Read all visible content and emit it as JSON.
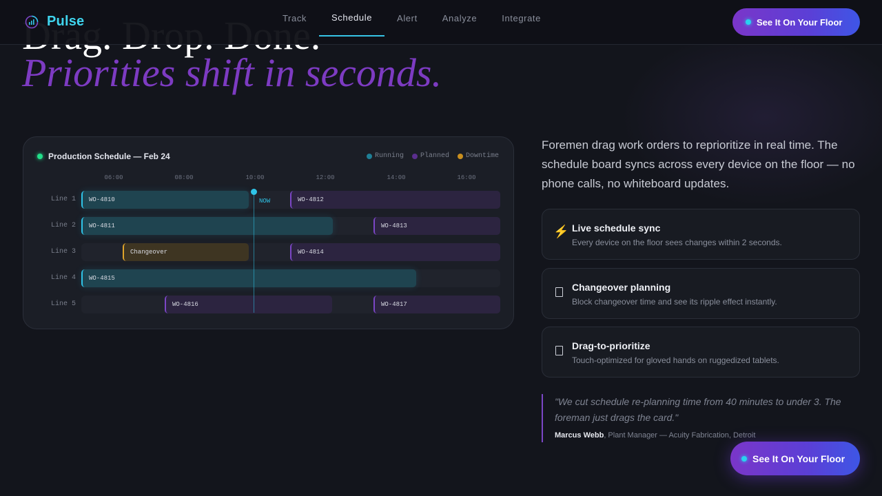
{
  "brand": {
    "name": "Pulse"
  },
  "nav": {
    "items": [
      {
        "label": "Track",
        "active": false
      },
      {
        "label": "Schedule",
        "active": true
      },
      {
        "label": "Alert",
        "active": false
      },
      {
        "label": "Analyze",
        "active": false
      },
      {
        "label": "Integrate",
        "active": false
      }
    ]
  },
  "cta": {
    "label": "See It On Your Floor",
    "bottom_label": "See It On Your Floor"
  },
  "hero": {
    "line1": "Drag. Drop. Done.",
    "line2": "Priorities shift in seconds."
  },
  "schedule": {
    "title": "Production Schedule — Feb 24",
    "legend": {
      "running": "Running",
      "planned": "Planned",
      "downtime": "Downtime"
    },
    "times": [
      "06:00",
      "08:00",
      "10:00",
      "12:00",
      "14:00",
      "16:00"
    ],
    "now_label": "NOW",
    "lines": [
      {
        "label": "Line 1",
        "orders": [
          {
            "id": "WO-4810",
            "status": "running"
          },
          {
            "id": "WO-4812",
            "status": "planned"
          }
        ]
      },
      {
        "label": "Line 2",
        "orders": [
          {
            "id": "WO-4811",
            "status": "running"
          },
          {
            "id": "WO-4813",
            "status": "planned"
          }
        ]
      },
      {
        "label": "Line 3",
        "orders": [
          {
            "id": "Changeover",
            "status": "downtime"
          },
          {
            "id": "WO-4814",
            "status": "planned"
          }
        ]
      },
      {
        "label": "Line 4",
        "orders": [
          {
            "id": "WO-4815",
            "status": "running"
          }
        ]
      },
      {
        "label": "Line 5",
        "orders": [
          {
            "id": "WO-4816",
            "status": "planned"
          },
          {
            "id": "WO-4817",
            "status": "planned"
          }
        ]
      }
    ],
    "colors": {
      "running": "#2fc4e8",
      "planned": "#7c46c6",
      "downtime": "#e0a52a",
      "live": "#22e08a"
    }
  },
  "description": "Foremen drag work orders to reprioritize in real time. The schedule board syncs across every device on the floor — no phone calls, no whiteboard updates.",
  "features": [
    {
      "icon": "lightning-icon",
      "glyph": "⚡",
      "title": "Live schedule sync",
      "text": "Every device on the floor sees changes within 2 seconds."
    },
    {
      "icon": "changeover-icon",
      "title": "Changeover planning",
      "text": "Block changeover time and see its ripple effect instantly."
    },
    {
      "icon": "drag-icon",
      "title": "Drag-to-prioritize",
      "text": "Touch-optimized for gloved hands on ruggedized tablets."
    }
  ],
  "testimonial": {
    "quote": "\"We cut schedule re-planning time from 40 minutes to under 3. The foreman just drags the card.\"",
    "name": "Marcus Webb",
    "role": ", Plant Manager — Acuity Fabrication, Detroit"
  }
}
